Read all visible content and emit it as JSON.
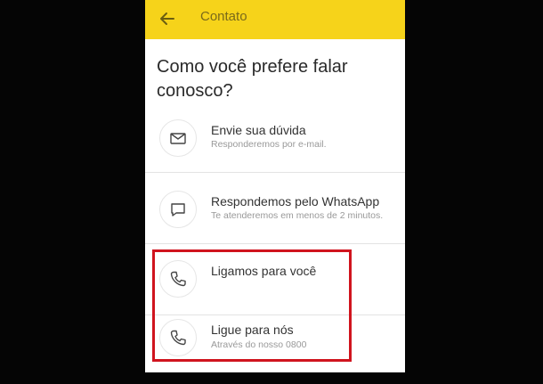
{
  "appbar": {
    "title": "Contato",
    "back_icon": "arrow-left-icon"
  },
  "heading": "Como você prefere falar conosco?",
  "options": [
    {
      "title": "Envie sua dúvida",
      "subtitle": "Responderemos por e-mail.",
      "icon": "mail-icon"
    },
    {
      "title": "Respondemos pelo WhatsApp",
      "subtitle": "Te atenderemos em menos de 2 minutos.",
      "icon": "chat-icon"
    },
    {
      "title": "Ligamos para você",
      "subtitle": "",
      "icon": "phone-icon"
    },
    {
      "title": "Ligue para nós",
      "subtitle": "Através do nosso 0800",
      "icon": "phone-icon"
    }
  ],
  "colors": {
    "appbar": "#f6d31a",
    "highlight": "#d0141e"
  }
}
